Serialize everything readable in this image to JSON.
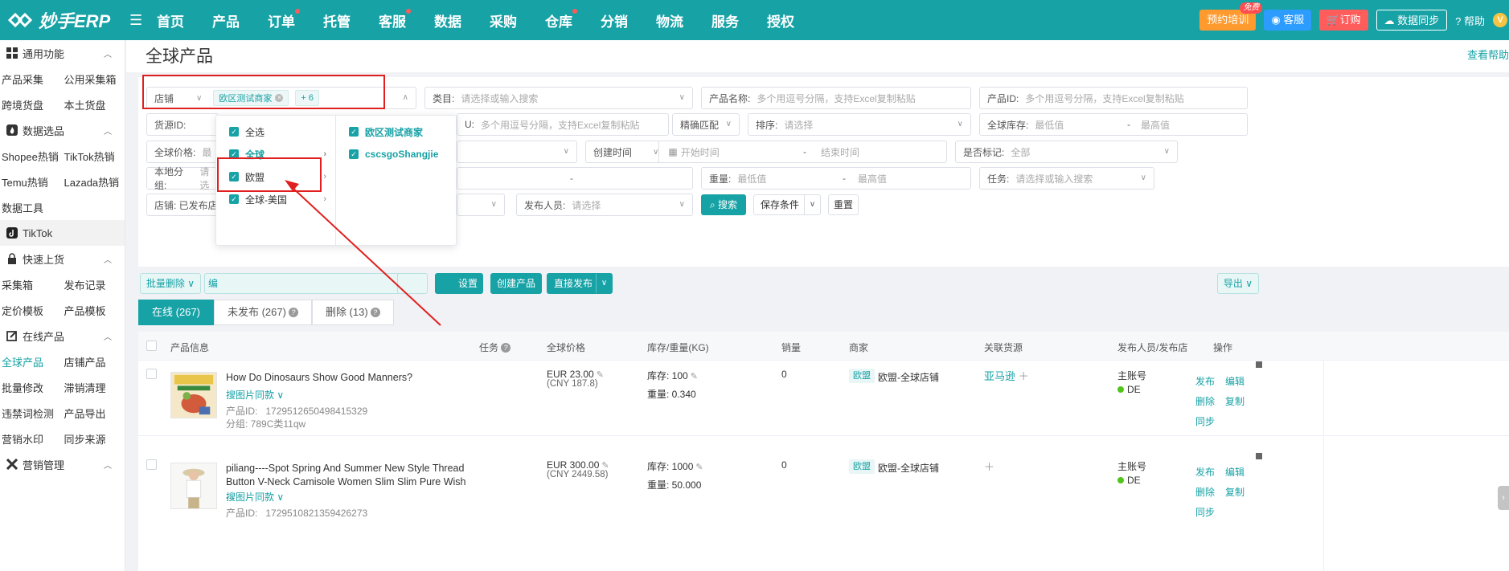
{
  "app": {
    "logo": "妙手ERP"
  },
  "nav": {
    "items": [
      {
        "label": "首页",
        "dot": false
      },
      {
        "label": "产品",
        "dot": false
      },
      {
        "label": "订单",
        "dot": true
      },
      {
        "label": "托管",
        "dot": false
      },
      {
        "label": "客服",
        "dot": true
      },
      {
        "label": "数据",
        "dot": false
      },
      {
        "label": "采购",
        "dot": false
      },
      {
        "label": "仓库",
        "dot": true
      },
      {
        "label": "分销",
        "dot": false
      },
      {
        "label": "物流",
        "dot": false
      },
      {
        "label": "服务",
        "dot": false
      },
      {
        "label": "授权",
        "dot": false
      }
    ],
    "training": "预约培训",
    "free_badge": "免费",
    "support": "客服",
    "order": "订购",
    "sync": "数据同步",
    "help": "帮助",
    "vip": "V"
  },
  "sidebar": {
    "group_common": "通用功能",
    "row1": [
      "产品采集",
      "公用采集箱"
    ],
    "row2": [
      "跨境货盘",
      "本土货盘"
    ],
    "group_data": "数据选品",
    "row3": [
      "Shopee热销",
      "TikTok热销"
    ],
    "row4": [
      "Temu热销",
      "Lazada热销"
    ],
    "row5": [
      "数据工具"
    ],
    "group_tiktok": "TikTok",
    "group_quick": "快速上货",
    "row6": [
      "采集箱",
      "发布记录"
    ],
    "row7": [
      "定价模板",
      "产品模板"
    ],
    "group_online": "在线产品",
    "row8": [
      "全球产品",
      "店铺产品"
    ],
    "row9": [
      "批量修改",
      "滞销清理"
    ],
    "row10": [
      "违禁词检测",
      "产品导出"
    ],
    "row11": [
      "营销水印",
      "同步来源"
    ],
    "group_marketing": "营销管理"
  },
  "page": {
    "title": "全球产品",
    "view_help": "查看帮助"
  },
  "filters": {
    "store_label": "店铺",
    "store_tag": "欧区测试商家",
    "store_more": "+ 6",
    "category_label": "类目:",
    "category_ph": "请选择或输入搜索",
    "pname_label": "产品名称:",
    "pname_ph": "多个用逗号分隔，支持Excel复制粘贴",
    "pid_label": "产品ID:",
    "pid_ph": "多个用逗号分隔，支持Excel复制粘贴",
    "source_label": "货源ID:",
    "sku_label": "U:",
    "sku_ph": "多个用逗号分隔，支持Excel复制粘贴",
    "match": "精确匹配",
    "sort_label": "排序:",
    "sort_ph": "请选择",
    "stock_label": "全球库存:",
    "min_ph": "最低值",
    "max_ph": "最高值",
    "dash": "-",
    "price_label": "全球价格:",
    "price_ph": "最",
    "created_label": "创建时间",
    "start_ph": "开始时间",
    "end_ph": "结束时间",
    "marked_label": "是否标记:",
    "marked_value": "全部",
    "group_label": "本地分组:",
    "group_ph": "请选",
    "weight_label": "重量:",
    "task_label": "任务:",
    "task_ph": "请选择或输入搜索",
    "store2_label": "店铺: 已发布店",
    "publisher_label": "发布人员:",
    "publisher_ph": "请选择",
    "search": "搜索",
    "save": "保存条件",
    "reset": "重置"
  },
  "dropdown": {
    "col1": [
      {
        "label": "全选",
        "arrow": false,
        "hl": false
      },
      {
        "label": "全球",
        "arrow": true,
        "hl": true
      },
      {
        "label": "欧盟",
        "arrow": true,
        "hl": false
      },
      {
        "label": "全球-美国",
        "arrow": true,
        "hl": false
      }
    ],
    "col2": [
      "欧区测试商家",
      "cscsgoShangjie"
    ]
  },
  "actions": {
    "batch_delete": "批量删除",
    "batch_edit_partial": "编",
    "settings_partial": "设置",
    "create": "创建产品",
    "publish": "直接发布",
    "export": "导出"
  },
  "tabs": [
    {
      "label": "在线 (267)",
      "active": true,
      "q": false
    },
    {
      "label": "未发布 (267)",
      "active": false,
      "q": true
    },
    {
      "label": "删除 (13)",
      "active": false,
      "q": true
    }
  ],
  "table": {
    "headers": {
      "info": "产品信息",
      "task": "任务",
      "price": "全球价格",
      "stock": "库存/重量(KG)",
      "sales": "销量",
      "merchant": "商家",
      "source": "关联货源",
      "publisher": "发布人员/发布店",
      "ops": "操作"
    },
    "rows": [
      {
        "name": "How Do Dinosaurs Show Good Manners?",
        "name2": "",
        "find_similar": "搜图片同款",
        "pid_label": "产品ID:",
        "pid": "1729512650498415329",
        "group": "分组: 789C类11qw",
        "price": "EUR 23.00",
        "cny": "(CNY 187.8)",
        "stock": "库存: 100",
        "weight": "重量: 0.340",
        "sales": "0",
        "market": "欧盟",
        "merchant": "欧盟-全球店铺",
        "source": "亚马逊",
        "publisher": "主账号",
        "site": "DE",
        "ops": [
          "发布",
          "编辑",
          "删除",
          "复制",
          "同步"
        ]
      },
      {
        "name": "piliang----Spot Spring And Summer New Style Thread",
        "name2": "Button V-Neck Camisole Women Slim Slim Pure Wish ...",
        "find_similar": "搜图片同款",
        "pid_label": "产品ID:",
        "pid": "1729510821359426273",
        "group": "",
        "price": "EUR 300.00",
        "cny": "(CNY 2449.58)",
        "stock": "库存: 1000",
        "weight": "重量: 50.000",
        "sales": "0",
        "market": "欧盟",
        "merchant": "欧盟-全球店铺",
        "source": "",
        "publisher": "主账号",
        "site": "DE",
        "ops": [
          "发布",
          "编辑",
          "删除",
          "复制",
          "同步"
        ]
      }
    ]
  },
  "colors": {
    "brand": "#17a2a6",
    "annotation": "#e02020"
  }
}
